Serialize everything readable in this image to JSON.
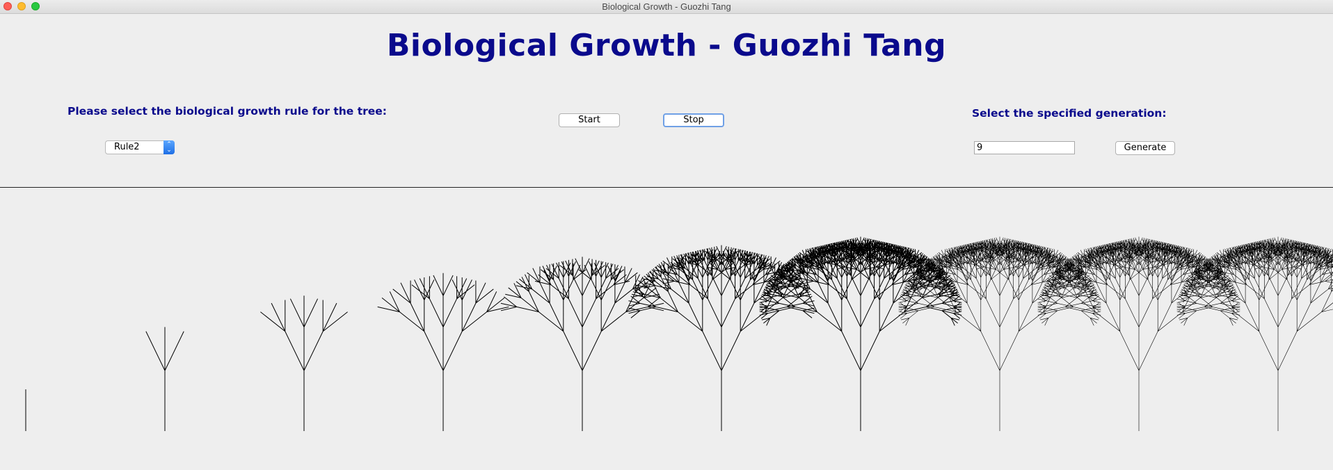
{
  "window": {
    "title": "Biological Growth - Guozhi Tang"
  },
  "header": {
    "title": "Biological Growth - Guozhi Tang"
  },
  "controls": {
    "rule_label": "Please select the biological growth rule for the tree:",
    "rule_selected": "Rule2",
    "start_label": "Start",
    "stop_label": "Stop",
    "generation_label": "Select the specified generation:",
    "generation_value": "9",
    "generate_label": "Generate"
  },
  "canvas": {
    "tree_color": "#000000",
    "generations_shown": 10
  }
}
